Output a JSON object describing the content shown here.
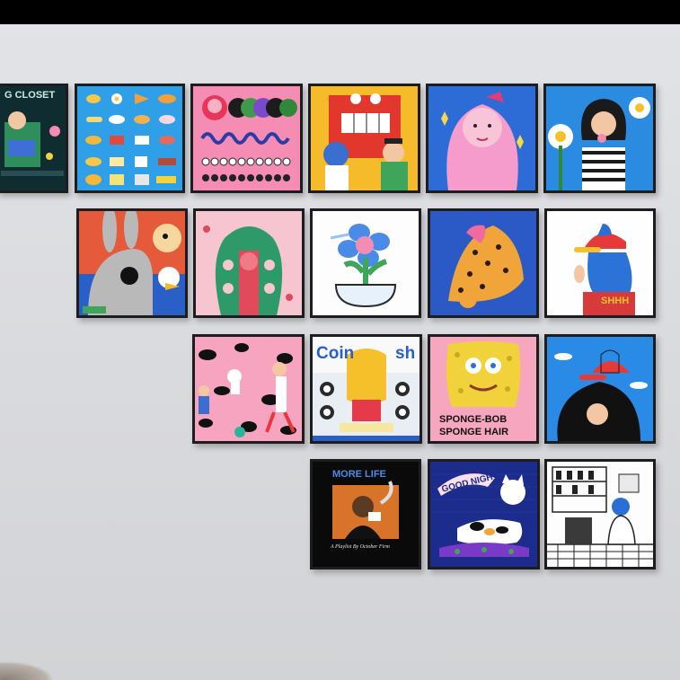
{
  "scene": "wall-of-framed-prints",
  "prints": {
    "r1c0": {
      "title": "G CLOSET"
    },
    "r3c3": {
      "title": "Coin",
      "title2": "sh"
    },
    "r3c4": {
      "line1": "SPONGE-BOB",
      "line2": "SPONGE HAIR"
    },
    "r2c5": {
      "text": "SHHH"
    },
    "r4c3": {
      "title": "MORE LIFE",
      "subtitle": "A Playlist By October Firm"
    },
    "r4c4": {
      "title": "GOOD NIGHT"
    }
  }
}
